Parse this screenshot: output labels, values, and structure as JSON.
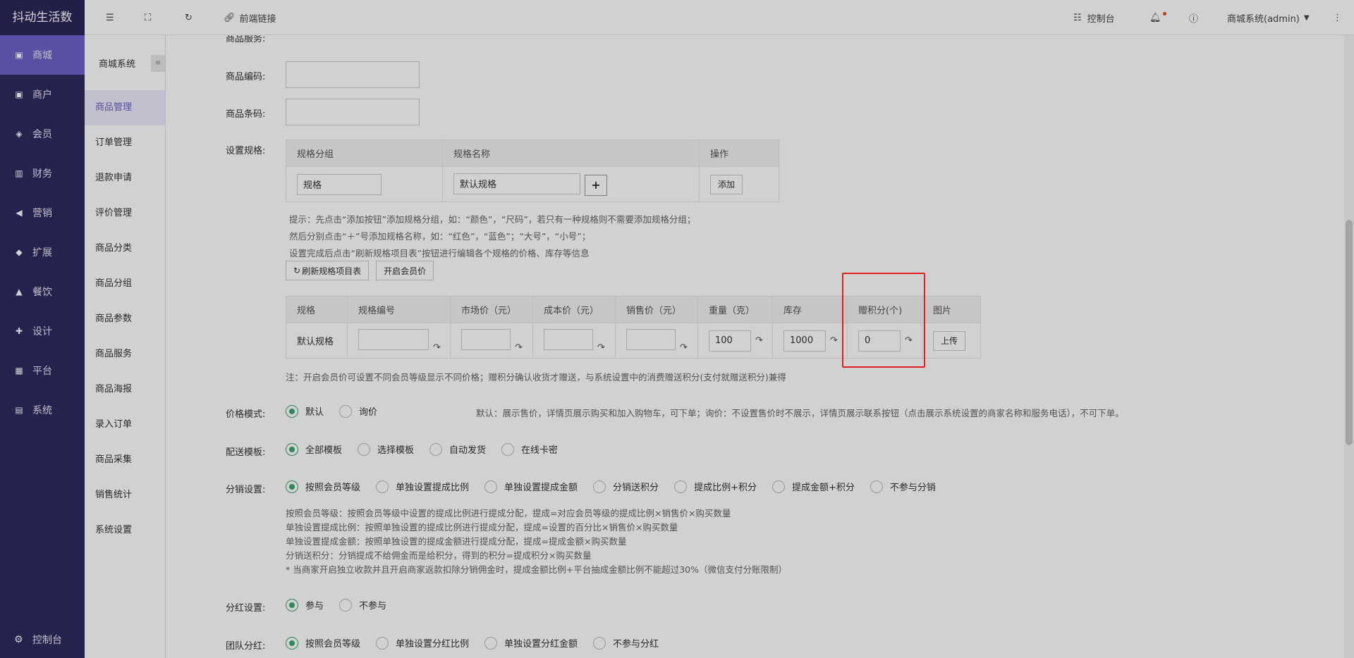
{
  "brand": "抖动生活数",
  "nav": [
    "商城",
    "商户",
    "会员",
    "财务",
    "营销",
    "扩展",
    "餐饮",
    "设计",
    "平台",
    "系统"
  ],
  "nav_bottom": "控制台",
  "sub": {
    "title": "商城系统",
    "collapse": "«",
    "items": [
      "商品管理",
      "订单管理",
      "退款申请",
      "评价管理",
      "商品分类",
      "商品分组",
      "商品参数",
      "商品服务",
      "商品海报",
      "录入订单",
      "商品采集",
      "销售统计",
      "系统设置"
    ]
  },
  "topbar": {
    "link": "前端链接",
    "console": "控制台",
    "user": "商城系统(admin)"
  },
  "form": {
    "service_label": "商品服务:",
    "code_label": "商品编码:",
    "barcode_label": "商品条码:",
    "spec_label": "设置规格:",
    "spec_table": {
      "headers": [
        "规格分组",
        "规格名称",
        "操作"
      ],
      "group_value": "规格",
      "name_value": "默认规格",
      "plus": "+",
      "add": "添加"
    },
    "spec_hints": [
      "提示：先点击“添加按钮”添加规格分组，如：“颜色”，“尺码”，若只有一种规格则不需要添加规格分组；",
      "然后分别点击“＋”号添加规格名称，如：“红色”，“蓝色”；“大号”，“小号”；",
      "设置完成后点击“刷新规格项目表”按钮进行编辑各个规格的价格、库存等信息"
    ],
    "refresh_btn": "刷新规格项目表",
    "member_price_btn": "开启会员价",
    "sku_table": {
      "headers": [
        "规格",
        "规格编号",
        "市场价（元）",
        "成本价（元）",
        "销售价（元）",
        "重量（克）",
        "库存",
        "赠积分(个)",
        "图片"
      ],
      "row_name": "默认规格",
      "weight": "100",
      "stock": "1000",
      "points": "0",
      "upload": "上传"
    },
    "sku_note": "注：开启会员价可设置不同会员等级显示不同价格；赠积分确认收货才赠送，与系统设置中的消费赠送积分(支付就赠送积分)兼得",
    "price_mode": {
      "label": "价格模式:",
      "options": [
        "默认",
        "询价"
      ],
      "selected": 0,
      "desc": "默认：展示售价，详情页展示购买和加入购物车，可下单；询价：不设置售价时不展示，详情页展示联系按钮（点击展示系统设置的商家名称和服务电话），不可下单。"
    },
    "delivery": {
      "label": "配送模板:",
      "options": [
        "全部模板",
        "选择模板",
        "自动发货",
        "在线卡密"
      ],
      "selected": 0
    },
    "distribution": {
      "label": "分销设置:",
      "options": [
        "按照会员等级",
        "单独设置提成比例",
        "单独设置提成金额",
        "分销送积分",
        "提成比例+积分",
        "提成金额+积分",
        "不参与分销"
      ],
      "selected": 0,
      "tips": [
        "按照会员等级：按照会员等级中设置的提成比例进行提成分配，提成=对应会员等级的提成比例×销售价×购买数量",
        "单独设置提成比例：按照单独设置的提成比例进行提成分配，提成=设置的百分比×销售价×购买数量",
        "单独设置提成金额：按照单独设置的提成金额进行提成分配，提成=提成金额×购买数量",
        "分销送积分：分销提成不给佣金而是给积分，得到的积分=提成积分×购买数量",
        "* 当商家开启独立收款并且开启商家返款扣除分销佣金时，提成金额比例+平台抽成金额比例不能超过30%（微信支付分账限制）"
      ]
    },
    "dividend": {
      "label": "分红设置:",
      "options": [
        "参与",
        "不参与"
      ],
      "selected": 0
    },
    "team_dividend": {
      "label": "团队分红:",
      "options": [
        "按照会员等级",
        "单独设置分红比例",
        "单独设置分红金额",
        "不参与分红"
      ],
      "selected": 0
    }
  },
  "colors": {
    "sidebar": "#2e2a60",
    "active": "#6c63c7",
    "radio": "#3aa76d",
    "highlight": "#e02020"
  }
}
